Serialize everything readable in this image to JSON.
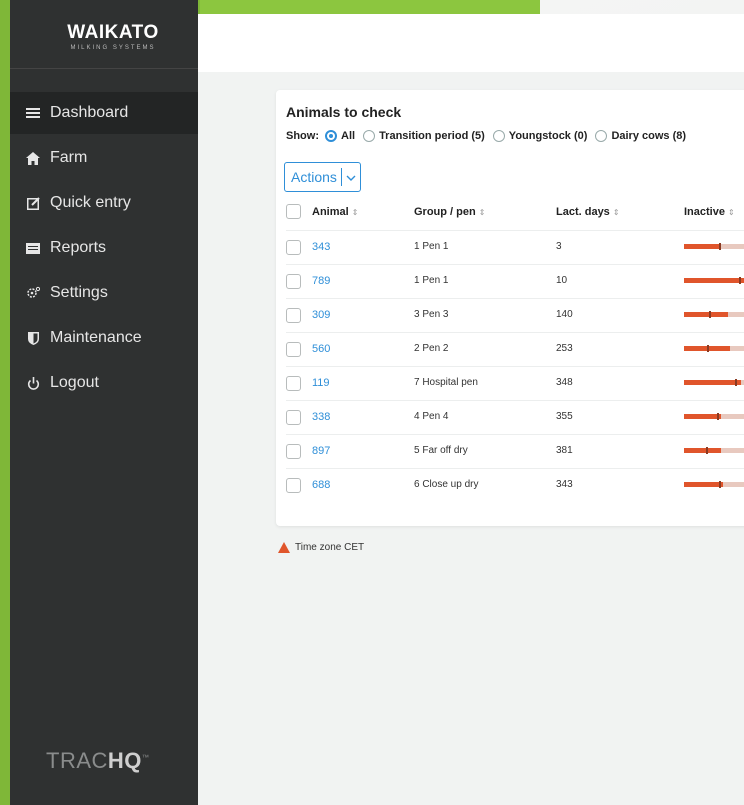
{
  "brand": {
    "logo_main": "WAIKATO",
    "logo_sub": "MILKING SYSTEMS",
    "product_light": "TRAC",
    "product_bold": "HQ",
    "product_tm": "™"
  },
  "nav": {
    "items": [
      {
        "label": "Dashboard",
        "icon": "dashboard-icon",
        "active": true
      },
      {
        "label": "Farm",
        "icon": "home-icon",
        "active": false
      },
      {
        "label": "Quick entry",
        "icon": "edit-icon",
        "active": false
      },
      {
        "label": "Reports",
        "icon": "reports-icon",
        "active": false
      },
      {
        "label": "Settings",
        "icon": "gear-icon",
        "active": false
      },
      {
        "label": "Maintenance",
        "icon": "shield-icon",
        "active": false
      },
      {
        "label": "Logout",
        "icon": "power-icon",
        "active": false
      }
    ]
  },
  "panel": {
    "title": "Animals to check",
    "show_label": "Show:",
    "filters": [
      {
        "label": "All",
        "checked": true
      },
      {
        "label": "Transition period (5)",
        "checked": false
      },
      {
        "label": "Youngstock (0)",
        "checked": false
      },
      {
        "label": "Dairy cows (8)",
        "checked": false
      }
    ],
    "actions_label": "Actions",
    "columns": {
      "animal": "Animal",
      "group": "Group / pen",
      "lact": "Lact. days",
      "inactive": "Inactive"
    },
    "rows": [
      {
        "animal": "343",
        "group": "1 Pen 1",
        "lact": "3",
        "inactive_fill": 0.4,
        "mark": 0.38
      },
      {
        "animal": "789",
        "group": "1 Pen 1",
        "lact": "10",
        "inactive_fill": 0.68,
        "mark": 0.6
      },
      {
        "animal": "309",
        "group": "3 Pen 3",
        "lact": "140",
        "inactive_fill": 0.48,
        "mark": 0.27
      },
      {
        "animal": "560",
        "group": "2 Pen 2",
        "lact": "253",
        "inactive_fill": 0.5,
        "mark": 0.25
      },
      {
        "animal": "119",
        "group": "7 Hospital pen",
        "lact": "348",
        "inactive_fill": 0.62,
        "mark": 0.55
      },
      {
        "animal": "338",
        "group": "4 Pen 4",
        "lact": "355",
        "inactive_fill": 0.4,
        "mark": 0.36
      },
      {
        "animal": "897",
        "group": "5 Far off dry",
        "lact": "381",
        "inactive_fill": 0.4,
        "mark": 0.24
      },
      {
        "animal": "688",
        "group": "6 Close up dry",
        "lact": "343",
        "inactive_fill": 0.42,
        "mark": 0.38
      }
    ]
  },
  "footer": {
    "timezone": "Time zone CET"
  },
  "colors": {
    "accent": "#2f8fd8",
    "warn": "#e0552b",
    "sidebar": "#2f3131",
    "brand_green": "#8cc63f"
  }
}
